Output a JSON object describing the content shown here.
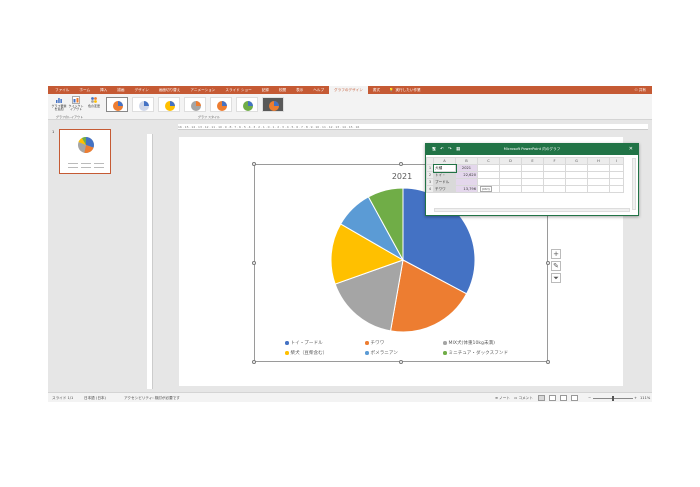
{
  "ribbon_tabs": [
    "ファイル",
    "ホーム",
    "挿入",
    "描画",
    "デザイン",
    "画面切り替え",
    "アニメーション",
    "スライド ショー",
    "記録",
    "校閲",
    "表示",
    "ヘルプ",
    "グラフのデザイン",
    "書式"
  ],
  "active_tab_index": 12,
  "tell_me": "実行したい作業",
  "share": "共有",
  "ribbon": {
    "add_element": "グラフ要素を追加",
    "quick_layout": "クイックレイアウト",
    "change_colors": "色の変更",
    "group_layouts": "グラフのレイアウト",
    "group_styles": "グラフ スタイル"
  },
  "ruler_text": "16 · 15 · 14 · 13 · 12 · 11 · 10 · 9 · 8 · 7 · 6 · 5 · 4 · 3 · 2 · 1 · 0 · 1 · 2 · 3 · 4 · 5 · 6 · 7 · 8 · 9 · 10 · 11 · 12 · 13 · 14 · 15 · 16",
  "slide_number": "1",
  "excel": {
    "title": "Microsoft PowerPoint 内のグラフ",
    "close": "✕",
    "quick_access": [
      "🖫",
      "↶",
      "↷",
      "▦"
    ],
    "col_headers": [
      "",
      "A",
      "B",
      "C",
      "D",
      "E",
      "F",
      "G",
      "H",
      "I"
    ],
    "rows": [
      [
        "1",
        "犬種",
        "2021"
      ],
      [
        "2",
        "トイ・",
        "22,620"
      ],
      [
        "3",
        "プードル",
        ""
      ],
      [
        "4",
        "チワワ",
        "13,796"
      ]
    ],
    "paste_tag": "(Ctrl)"
  },
  "chart_data": {
    "type": "pie",
    "title": "2021",
    "categories": [
      "トイ・プードル",
      "チワワ",
      "MIX犬(体重10kg未満)",
      "柴犬（豆柴含む）",
      "ポメラニアン",
      "ミニチュア・ダックスフンド"
    ],
    "values": [
      22620,
      13796,
      11600,
      9500,
      6000,
      5500
    ],
    "colors": [
      "#4472c4",
      "#ed7d31",
      "#a5a5a5",
      "#ffc000",
      "#5b9bd5",
      "#70ad47"
    ],
    "legend_position": "bottom"
  },
  "status": {
    "slide": "スライド 1/1",
    "language": "日本語 (日本)",
    "accessibility": "アクセシビリティ: 検討が必要です",
    "notes": "ノート",
    "comments": "コメント",
    "zoom": "111%"
  }
}
